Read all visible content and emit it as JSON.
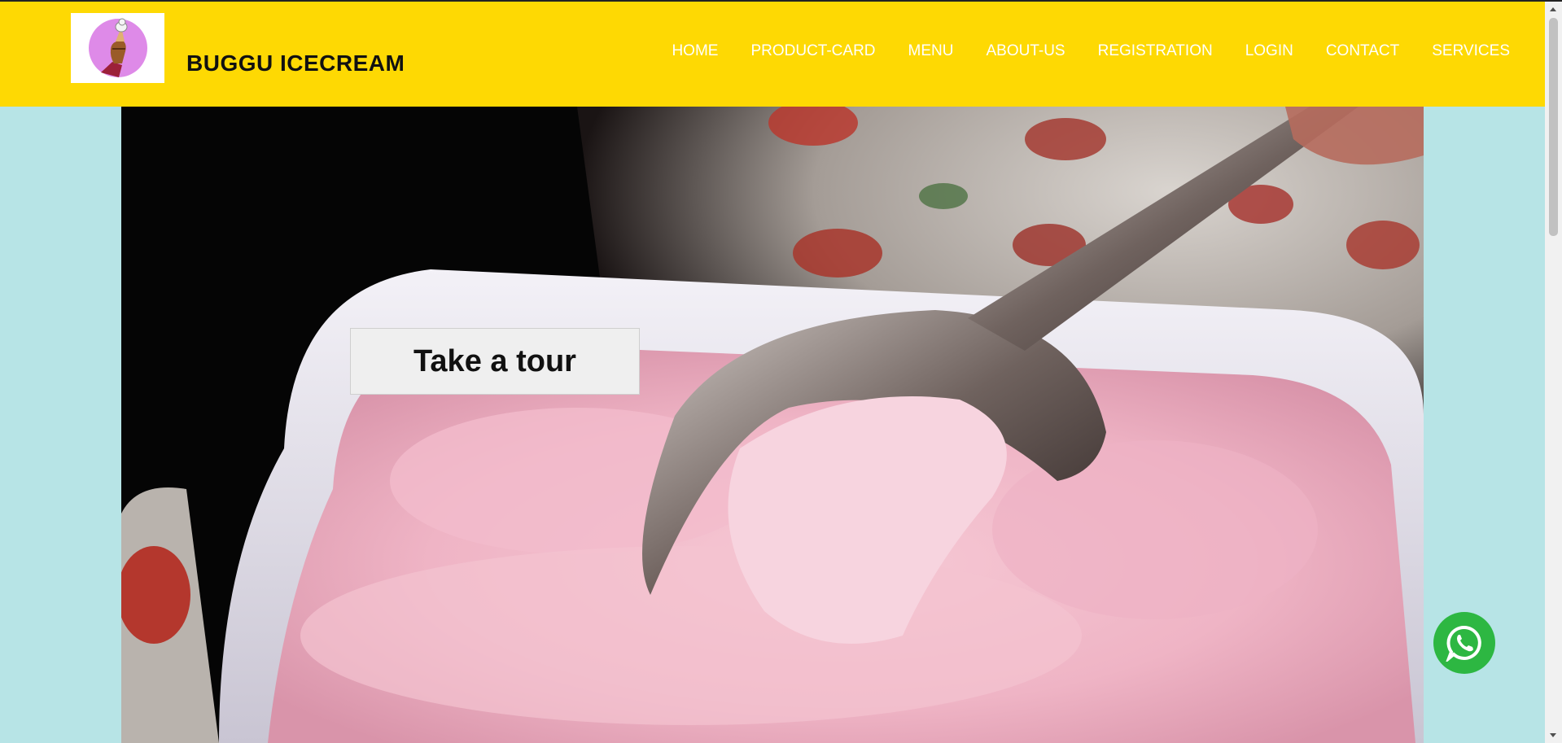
{
  "brand": {
    "name": "BUGGU ICECREAM",
    "logo_icon": "ice-cream-hand-icon"
  },
  "nav": {
    "items": [
      "HOME",
      "PRODUCT-CARD",
      "MENU",
      "ABOUT-US",
      "REGISTRATION",
      "LOGIN",
      "CONTACT",
      "SERVICES"
    ]
  },
  "hero": {
    "image": "strawberry-ice-cream-spoon-photo",
    "cta_label": "Take a tour"
  },
  "whatsapp": {
    "icon": "whatsapp-icon"
  },
  "colors": {
    "header_bg": "#fed903",
    "page_bg": "#b7e4e6",
    "nav_text": "#ffffff",
    "whatsapp": "#2db742"
  }
}
